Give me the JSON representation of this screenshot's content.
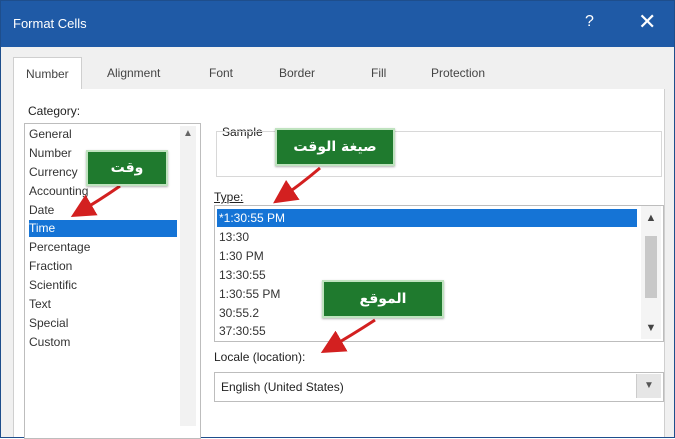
{
  "window": {
    "title": "Format Cells",
    "help": "?",
    "close": "✕"
  },
  "tabs": [
    "Number",
    "Alignment",
    "Font",
    "Border",
    "Fill",
    "Protection"
  ],
  "category": {
    "label": "Category:",
    "items": [
      "General",
      "Number",
      "Currency",
      "Accounting",
      "Date",
      "Time",
      "Percentage",
      "Fraction",
      "Scientific",
      "Text",
      "Special",
      "Custom"
    ],
    "selected": "Time"
  },
  "sample": {
    "label": "Sample"
  },
  "type": {
    "label": "Type:",
    "items": [
      "*1:30:55 PM",
      "13:30",
      "1:30 PM",
      "13:30:55",
      "1:30:55 PM",
      "30:55.2",
      "37:30:55"
    ],
    "selected": "*1:30:55 PM"
  },
  "locale": {
    "label": "Locale (location):",
    "value": "English (United States)"
  },
  "annotations": {
    "time": "وقت",
    "time_format": "صيغة الوقت",
    "locale": "الموقع"
  },
  "colors": {
    "titlebar": "#1f5aa6",
    "selection": "#1574d6",
    "callout": "#1f7a2e",
    "arrow": "#d32020"
  }
}
